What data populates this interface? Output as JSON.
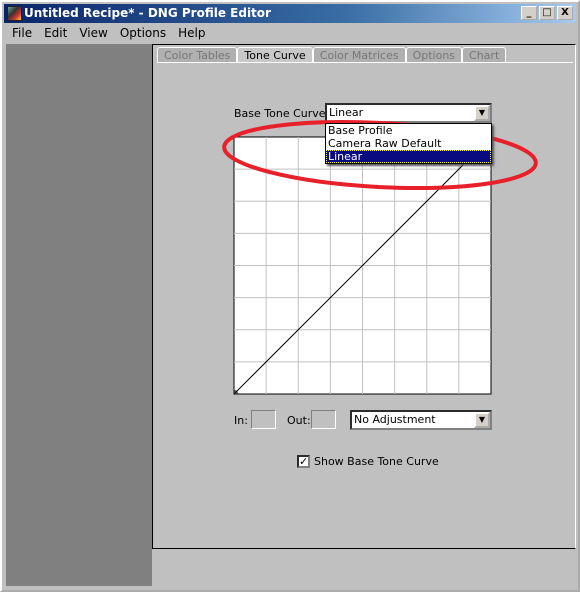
{
  "window": {
    "title": "Untitled Recipe* - DNG Profile Editor",
    "buttons": [
      "_",
      "□",
      "X"
    ]
  },
  "menu": [
    "File",
    "Edit",
    "View",
    "Options",
    "Help"
  ],
  "tabs": [
    {
      "label": "Color Tables",
      "active": false
    },
    {
      "label": "Tone Curve",
      "active": true
    },
    {
      "label": "Color Matrices",
      "active": false
    },
    {
      "label": "Options",
      "active": false
    },
    {
      "label": "Chart",
      "active": false
    }
  ],
  "base_tone_curve": {
    "label": "Base Tone Curve:",
    "value": "Linear",
    "options": [
      "Base Profile",
      "Camera Raw Default",
      "Linear"
    ],
    "selected_index": 2
  },
  "curve": {
    "points": [
      [
        0,
        0
      ],
      [
        1,
        1
      ]
    ],
    "grid_divisions": 8
  },
  "in_label": "In:",
  "in_value": "",
  "out_label": "Out:",
  "out_value": "",
  "adjustment": {
    "value": "No Adjustment"
  },
  "show_base": {
    "label": "Show Base Tone Curve",
    "checked": true
  },
  "annotation_color": "#e8202a"
}
